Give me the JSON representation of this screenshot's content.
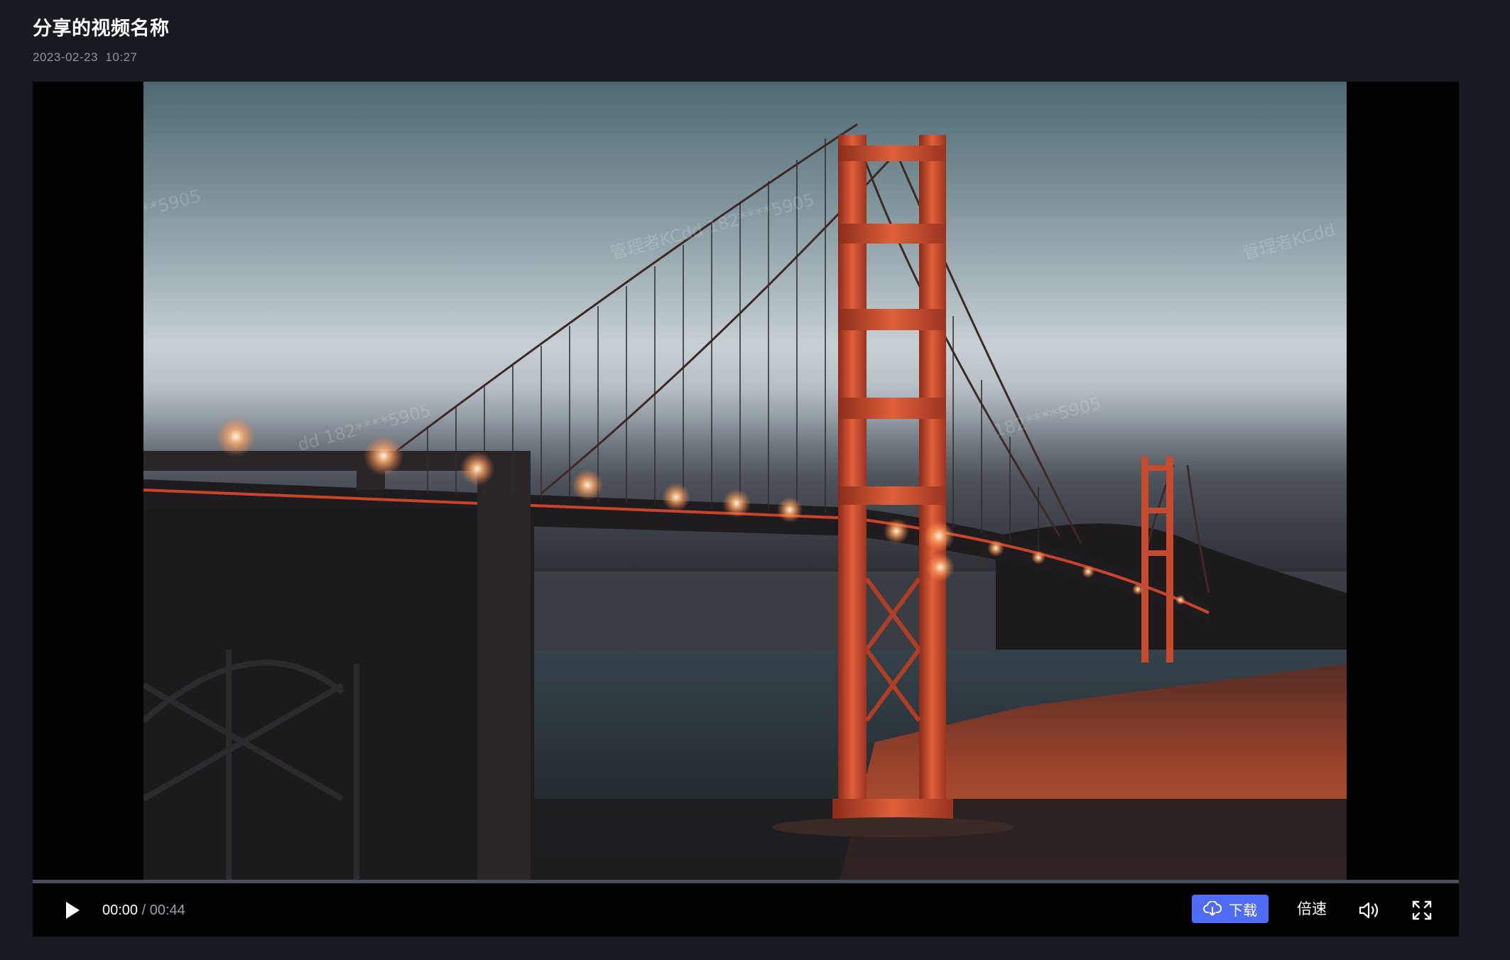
{
  "video": {
    "title": "分享的视频名称",
    "date": "2023-02-23  10:27"
  },
  "watermark": {
    "text": "管理者KCdd 182****5905",
    "fragment_a": "**5905",
    "fragment_b": "管理者KCdd 182****5905",
    "fragment_c": "管理者KCdd",
    "fragment_d": "dd 182****5905",
    "fragment_e": "182****5905"
  },
  "player": {
    "progress": 0.0,
    "current_time": "00:00",
    "separator": "/",
    "duration": "00:44",
    "download_label": "下载",
    "speed_label": "倍速"
  },
  "icons": {
    "play": "play-icon",
    "download": "cloud-download-icon",
    "volume": "volume-icon",
    "fullscreen": "fullscreen-icon"
  },
  "colors": {
    "page_background": "#181a21",
    "accent": "#4f6bf7",
    "bridge": "#c8452a"
  }
}
